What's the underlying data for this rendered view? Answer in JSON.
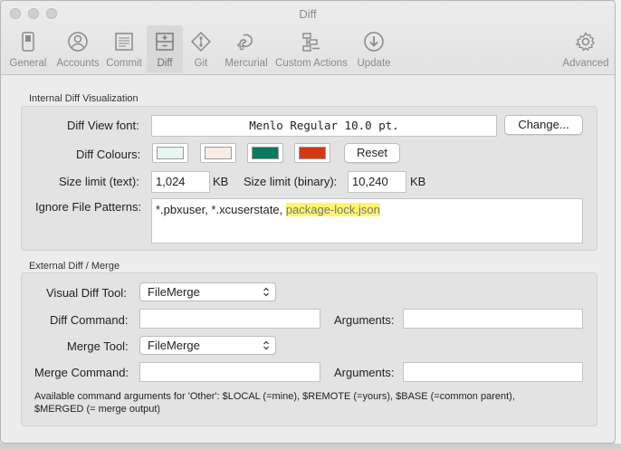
{
  "window": {
    "title": "Diff"
  },
  "toolbar": {
    "items": [
      {
        "label": "General",
        "icon": "switch-icon"
      },
      {
        "label": "Accounts",
        "icon": "account-icon"
      },
      {
        "label": "Commit",
        "icon": "document-icon"
      },
      {
        "label": "Diff",
        "icon": "diff-icon"
      },
      {
        "label": "Git",
        "icon": "git-icon"
      },
      {
        "label": "Mercurial",
        "icon": "mercurial-icon"
      },
      {
        "label": "Custom Actions",
        "icon": "custom-actions-icon"
      },
      {
        "label": "Update",
        "icon": "update-icon"
      },
      {
        "label": "Advanced",
        "icon": "gear-icon"
      }
    ],
    "active": "Diff"
  },
  "internal": {
    "title": "Internal Diff Visualization",
    "font_label": "Diff View font:",
    "font_value": "Menlo Regular 10.0 pt.",
    "change_button": "Change...",
    "colours_label": "Diff Colours:",
    "colours": [
      "#e8f6f2",
      "#f9ece8",
      "#0a7a5f",
      "#d43a12"
    ],
    "reset_button": "Reset",
    "size_text_label": "Size limit (text):",
    "size_text_value": "1,024",
    "size_text_unit": "KB",
    "size_binary_label": "Size limit (binary):",
    "size_binary_value": "10,240",
    "size_binary_unit": "KB",
    "ignore_label": "Ignore File Patterns:",
    "ignore_plain": "*.pbxuser, *.xcuserstate, ",
    "ignore_highlight": "package-lock.json"
  },
  "external": {
    "title": "External Diff / Merge",
    "visual_tool_label": "Visual Diff Tool:",
    "visual_tool_value": "FileMerge",
    "diff_command_label": "Diff Command:",
    "diff_command_value": "",
    "diff_arguments_label": "Arguments:",
    "diff_arguments_value": "",
    "merge_tool_label": "Merge Tool:",
    "merge_tool_value": "FileMerge",
    "merge_command_label": "Merge Command:",
    "merge_command_value": "",
    "merge_arguments_label": "Arguments:",
    "merge_arguments_value": "",
    "note_line1": "Available command arguments for 'Other': $LOCAL (=mine), $REMOTE (=yours), $BASE (=common parent),",
    "note_line2": "$MERGED (= merge output)"
  }
}
